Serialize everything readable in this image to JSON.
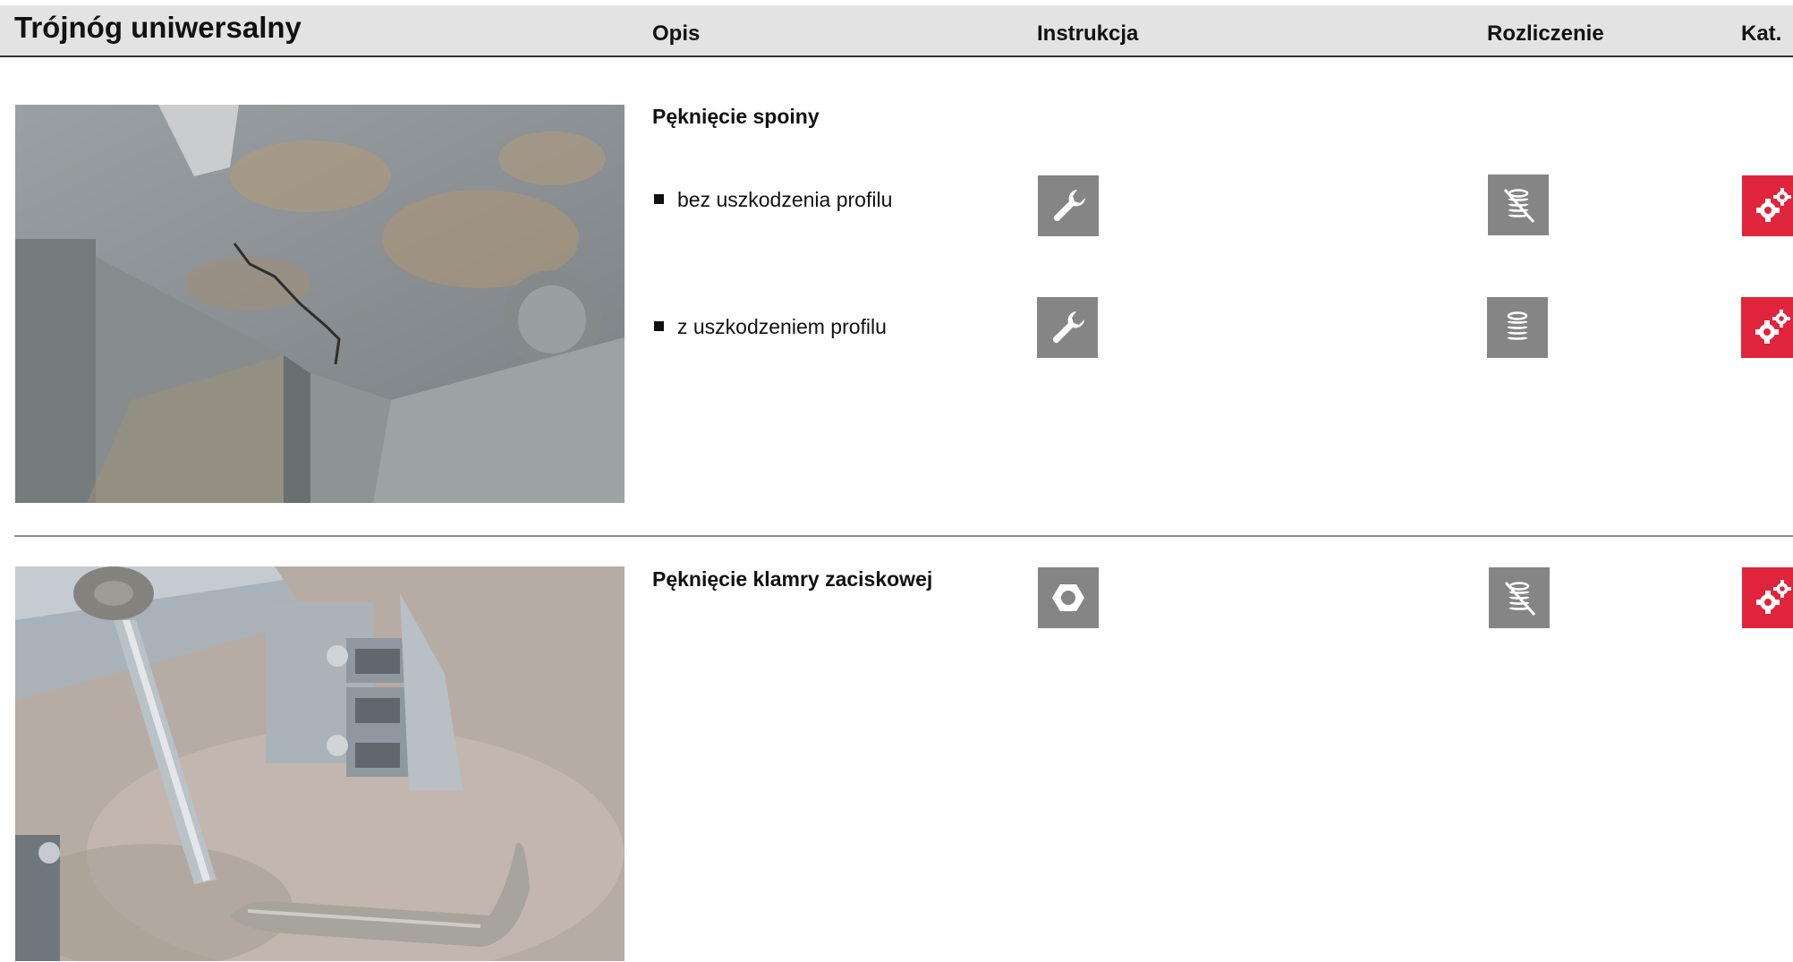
{
  "header": {
    "title": "Trójnóg uniwersalny",
    "columns": {
      "opis": "Opis",
      "instrukcja": "Instrukcja",
      "rozliczenie": "Rozliczenie",
      "kat": "Kat."
    }
  },
  "sections": [
    {
      "title": "Pęknięcie spoiny",
      "photo": "weld-crack-photo",
      "items": [
        {
          "label": "bez uszkodzenia profilu",
          "instruction_icon": "wrench-icon",
          "billing_icon": "coins-crossed-icon",
          "category_icon": "gears-icon"
        },
        {
          "label": "z uszkodzeniem profilu",
          "instruction_icon": "wrench-icon",
          "billing_icon": "coins-icon",
          "category_icon": "gears-icon"
        }
      ]
    },
    {
      "title": "Pęknięcie klamry zaciskowej",
      "photo": "clamp-crack-photo",
      "instruction_icon": "nut-icon",
      "billing_icon": "coins-crossed-icon",
      "category_icon": "gears-icon"
    }
  ],
  "colors": {
    "header_bg": "#e3e3e3",
    "icon_gray": "#858585",
    "icon_red": "#e0243c"
  }
}
